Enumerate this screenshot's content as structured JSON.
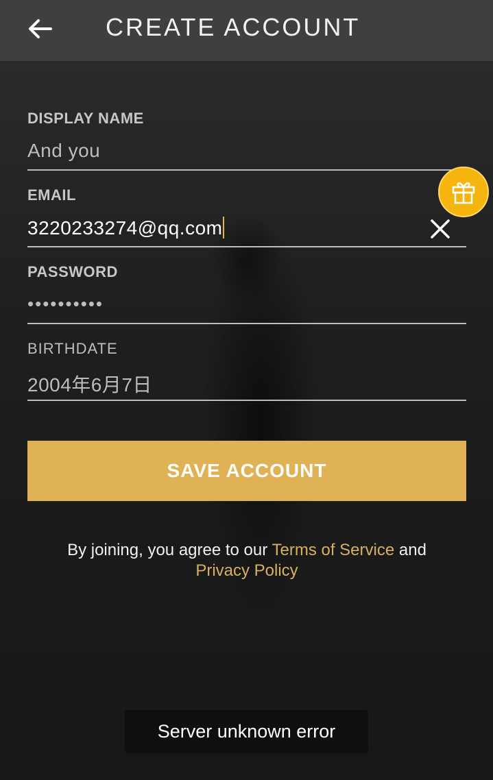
{
  "header": {
    "title": "CREATE ACCOUNT",
    "back_icon": "arrow-left-icon"
  },
  "form": {
    "display_name": {
      "label": "DISPLAY NAME",
      "value": "And you"
    },
    "email": {
      "label": "EMAIL",
      "value": "3220233274@qq.com",
      "clear_icon": "close-icon"
    },
    "password": {
      "label": "PASSWORD",
      "value": "••••••••••"
    },
    "birthdate": {
      "label": "BIRTHDATE",
      "value": "2004年6月7日"
    }
  },
  "gift_button": {
    "icon": "gift-icon",
    "color": "#f6b40f"
  },
  "save_button": {
    "label": "SAVE ACCOUNT",
    "color": "#dfb355"
  },
  "terms": {
    "prefix": "By joining, you agree to our ",
    "tos_link": "Terms of Service",
    "middle": " and",
    "privacy_link": "Privacy Policy"
  },
  "toast": {
    "message": "Server unknown error"
  }
}
